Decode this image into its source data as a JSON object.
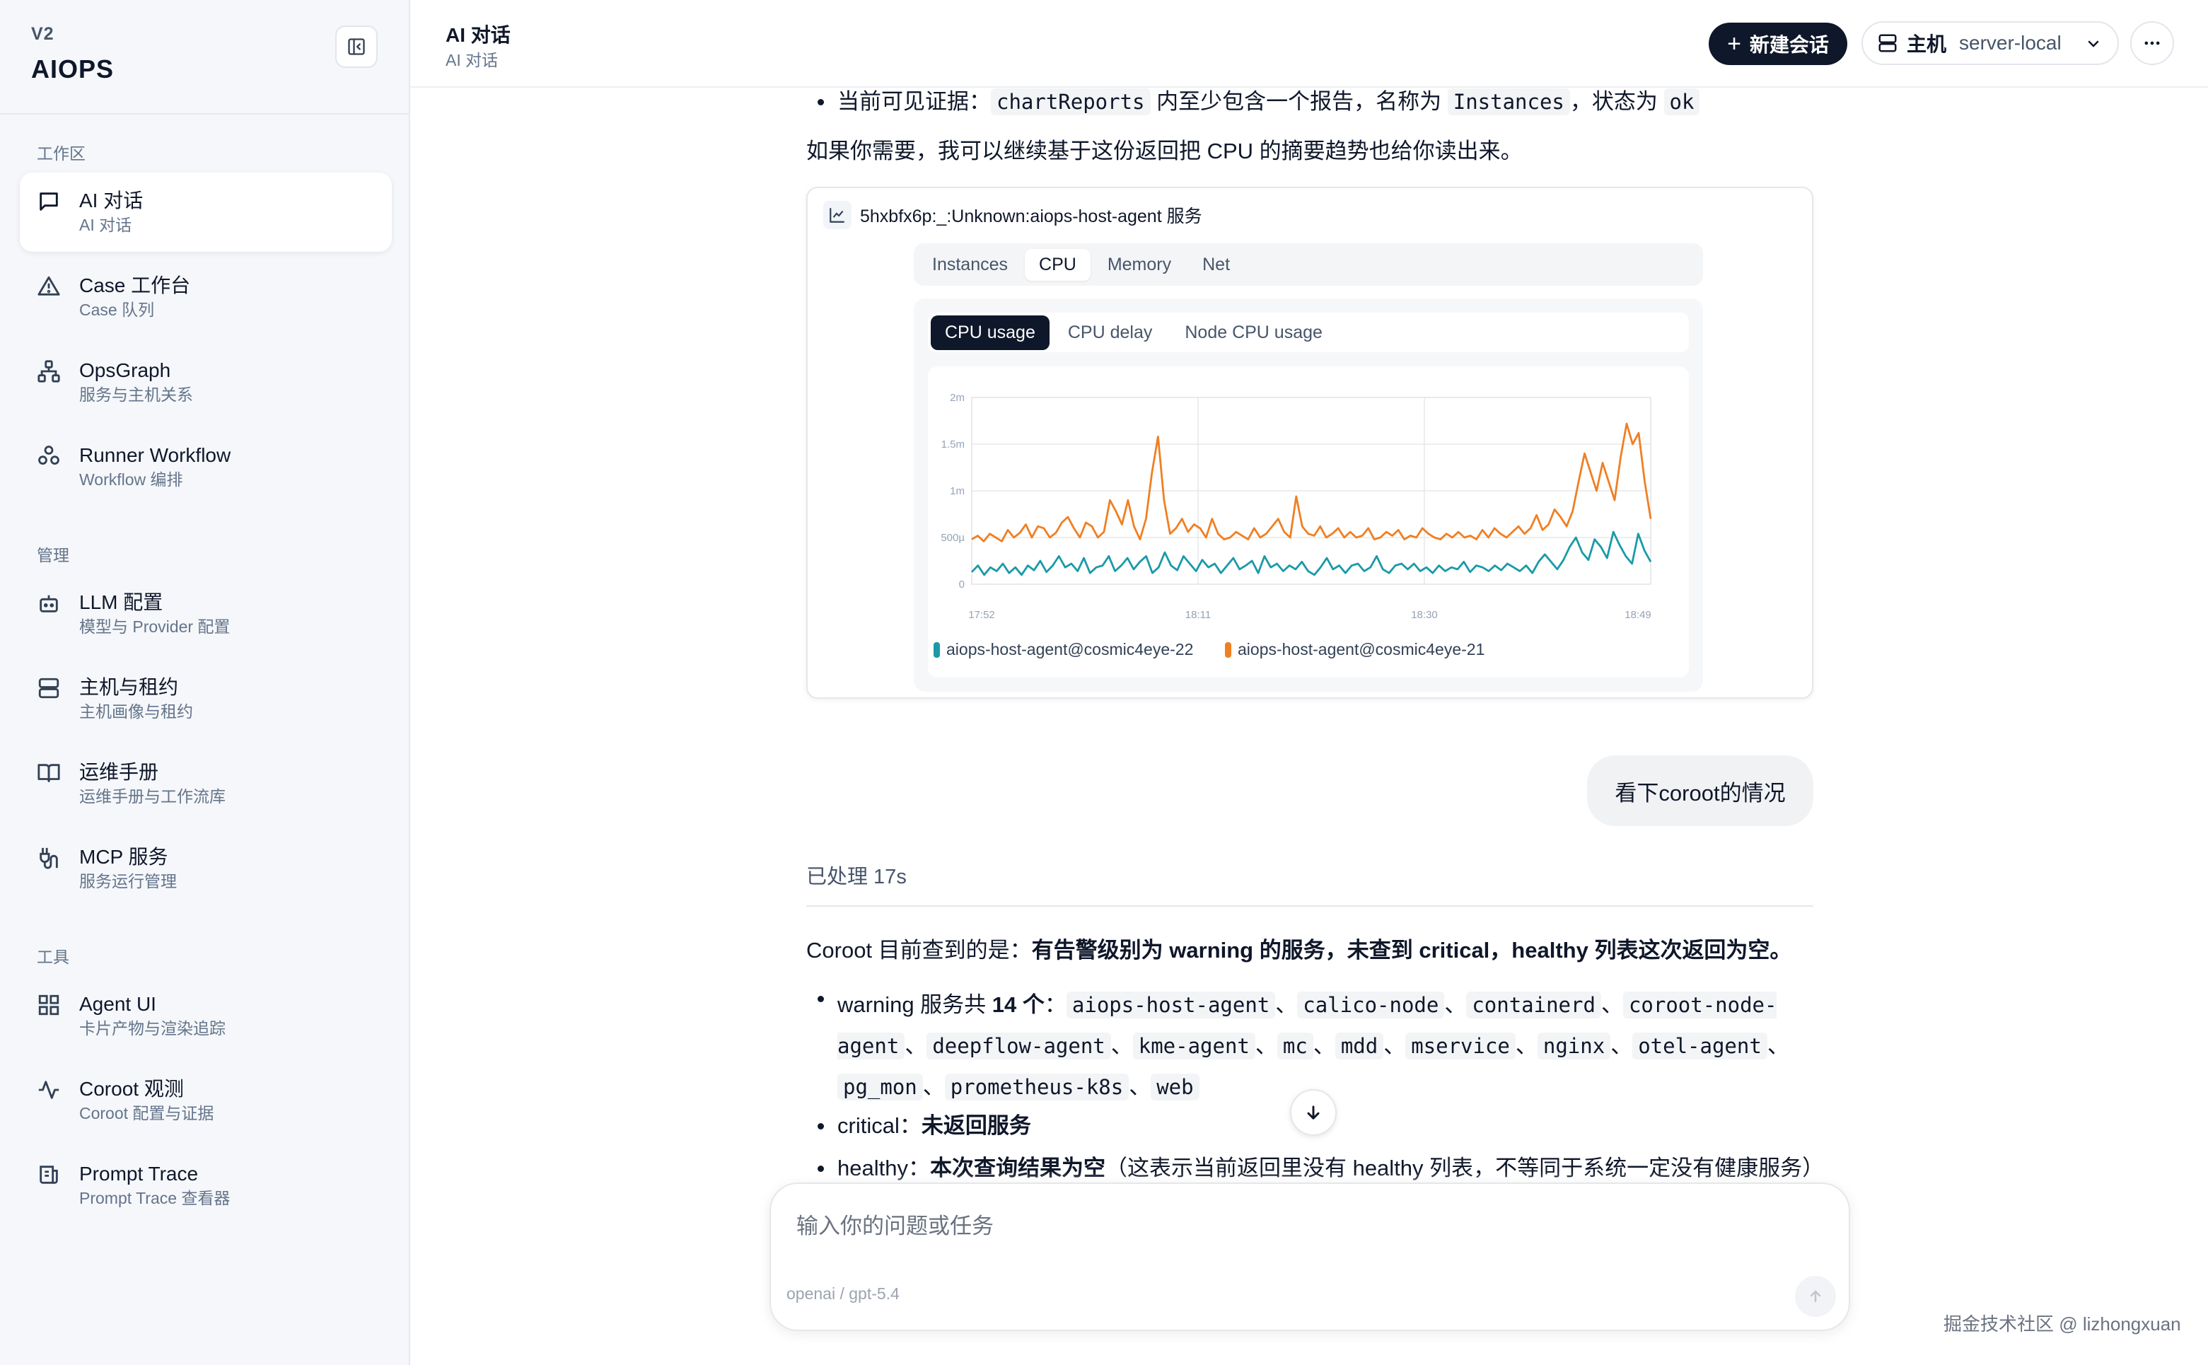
{
  "brand": {
    "version": "V2",
    "name": "AIOPS"
  },
  "sidebar": {
    "sections": [
      {
        "label": "工作区"
      },
      {
        "label": "管理"
      },
      {
        "label": "工具"
      }
    ],
    "items": [
      {
        "title": "AI 对话",
        "sub": "AI 对话",
        "icon": "chat-icon"
      },
      {
        "title": "Case 工作台",
        "sub": "Case 队列",
        "icon": "alert-triangle-icon"
      },
      {
        "title": "OpsGraph",
        "sub": "服务与主机关系",
        "icon": "graph-icon"
      },
      {
        "title": "Runner Workflow",
        "sub": "Workflow 编排",
        "icon": "workflow-icon"
      },
      {
        "title": "LLM 配置",
        "sub": "模型与 Provider 配置",
        "icon": "bot-icon"
      },
      {
        "title": "主机与租约",
        "sub": "主机画像与租约",
        "icon": "server-icon"
      },
      {
        "title": "运维手册",
        "sub": "运维手册与工作流库",
        "icon": "book-icon"
      },
      {
        "title": "MCP 服务",
        "sub": "服务运行管理",
        "icon": "plug-icon"
      },
      {
        "title": "Agent UI",
        "sub": "卡片产物与渲染追踪",
        "icon": "grid-icon"
      },
      {
        "title": "Coroot 观测",
        "sub": "Coroot 配置与证据",
        "icon": "activity-icon"
      },
      {
        "title": "Prompt Trace",
        "sub": "Prompt Trace 查看器",
        "icon": "scroll-icon"
      }
    ]
  },
  "header": {
    "title": "AI 对话",
    "subtitle": "AI 对话",
    "new_chat_label": "新建会话",
    "host_label": "主机",
    "host_value": "server-local"
  },
  "messages": {
    "evidence_prefix": "当前可见证据：",
    "evidence_code1": "chartReports",
    "evidence_mid": " 内至少包含一个报告，名称为 ",
    "evidence_code2": "Instances",
    "evidence_mid2": "，状态为 ",
    "evidence_code3": "ok",
    "followup": "如果你需要，我可以继续基于这份返回把 CPU 的摘要趋势也给你读出来。",
    "user_message": "看下coroot的情况",
    "processed": "已处理 17s",
    "summary_prefix": "Coroot 目前查到的是：",
    "summary_bold": "有告警级别为 warning 的服务，未查到 critical，healthy 列表这次返回为空。",
    "warning_prefix": "warning 服务共 ",
    "warning_count": "14 个",
    "warning_colon": "：",
    "services": [
      "aiops-host-agent",
      "calico-node",
      "containerd",
      "coroot-node-agent",
      "deepflow-agent",
      "kme-agent",
      "mc",
      "mdd",
      "mservice",
      "nginx",
      "otel-agent",
      "pg_mon",
      "prometheus-k8s",
      "web"
    ],
    "critical_prefix": "critical：",
    "critical_value": "未返回服务",
    "healthy_prefix": "healthy：",
    "healthy_bold": "本次查询结果为空",
    "healthy_note": "（这表示当前返回里没有 healthy 列表，不等同于系统一定没有健康服务）"
  },
  "chart_card": {
    "title": "5hxbfx6p:_:Unknown:aiops-host-agent 服务",
    "tabs": [
      "Instances",
      "CPU",
      "Memory",
      "Net"
    ],
    "active_tab": "CPU",
    "subtabs": [
      "CPU usage",
      "CPU delay",
      "Node CPU usage"
    ],
    "active_subtab": "CPU usage"
  },
  "chart_data": {
    "type": "line",
    "title": "",
    "ylabel": "",
    "xlabel": "",
    "x_ticks": [
      "17:52",
      "18:11",
      "18:30",
      "18:49"
    ],
    "y_ticks": [
      "0",
      "500µ",
      "1m",
      "1.5m",
      "2m"
    ],
    "ylim": [
      0,
      2
    ],
    "y_unit": "ms",
    "grid": true,
    "legend_position": "bottom",
    "series": [
      {
        "name": "aiops-host-agent@cosmic4eye-22",
        "color": "#1a9aa8",
        "values": [
          0.13,
          0.2,
          0.1,
          0.18,
          0.14,
          0.22,
          0.12,
          0.18,
          0.1,
          0.2,
          0.15,
          0.25,
          0.13,
          0.2,
          0.3,
          0.18,
          0.22,
          0.14,
          0.28,
          0.12,
          0.18,
          0.2,
          0.3,
          0.14,
          0.2,
          0.28,
          0.16,
          0.24,
          0.3,
          0.12,
          0.18,
          0.34,
          0.2,
          0.15,
          0.3,
          0.22,
          0.14,
          0.26,
          0.18,
          0.22,
          0.12,
          0.2,
          0.28,
          0.16,
          0.2,
          0.25,
          0.12,
          0.3,
          0.18,
          0.22,
          0.14,
          0.2,
          0.16,
          0.24,
          0.14,
          0.1,
          0.18,
          0.28,
          0.16,
          0.2,
          0.12,
          0.2,
          0.22,
          0.14,
          0.18,
          0.3,
          0.16,
          0.12,
          0.2,
          0.22,
          0.16,
          0.22,
          0.14,
          0.18,
          0.12,
          0.2,
          0.14,
          0.18,
          0.16,
          0.24,
          0.13,
          0.2,
          0.18,
          0.14,
          0.2,
          0.15,
          0.22,
          0.18,
          0.14,
          0.2,
          0.12,
          0.24,
          0.32,
          0.24,
          0.16,
          0.26,
          0.4,
          0.5,
          0.34,
          0.26,
          0.48,
          0.4,
          0.28,
          0.56,
          0.42,
          0.3,
          0.22,
          0.54,
          0.36,
          0.24
        ]
      },
      {
        "name": "aiops-host-agent@cosmic4eye-21",
        "color": "#f07f22",
        "values": [
          0.48,
          0.52,
          0.46,
          0.54,
          0.5,
          0.46,
          0.58,
          0.5,
          0.55,
          0.64,
          0.5,
          0.62,
          0.6,
          0.5,
          0.55,
          0.66,
          0.72,
          0.6,
          0.5,
          0.66,
          0.62,
          0.5,
          0.56,
          0.9,
          0.78,
          0.64,
          0.9,
          0.62,
          0.48,
          0.7,
          1.2,
          1.58,
          0.9,
          0.54,
          0.6,
          0.7,
          0.56,
          0.64,
          0.6,
          0.5,
          0.7,
          0.54,
          0.48,
          0.5,
          0.56,
          0.52,
          0.48,
          0.6,
          0.5,
          0.54,
          0.62,
          0.7,
          0.56,
          0.5,
          0.94,
          0.62,
          0.54,
          0.52,
          0.62,
          0.5,
          0.54,
          0.6,
          0.5,
          0.56,
          0.5,
          0.52,
          0.6,
          0.48,
          0.5,
          0.56,
          0.52,
          0.58,
          0.48,
          0.52,
          0.5,
          0.6,
          0.54,
          0.5,
          0.48,
          0.54,
          0.5,
          0.56,
          0.5,
          0.52,
          0.48,
          0.58,
          0.5,
          0.6,
          0.54,
          0.5,
          0.56,
          0.62,
          0.54,
          0.6,
          0.74,
          0.58,
          0.64,
          0.8,
          0.72,
          0.62,
          0.78,
          1.1,
          1.4,
          1.2,
          1.0,
          1.3,
          1.1,
          0.9,
          1.36,
          1.72,
          1.5,
          1.62,
          1.1,
          0.7
        ]
      }
    ]
  },
  "composer": {
    "placeholder": "输入你的问题或任务",
    "model": "openai / gpt-5.4"
  },
  "watermark": "掘金技术社区 @ lizhongxuan",
  "colors": {
    "accent": "#0f172a",
    "series_teal": "#1a9aa8",
    "series_orange": "#f07f22"
  }
}
